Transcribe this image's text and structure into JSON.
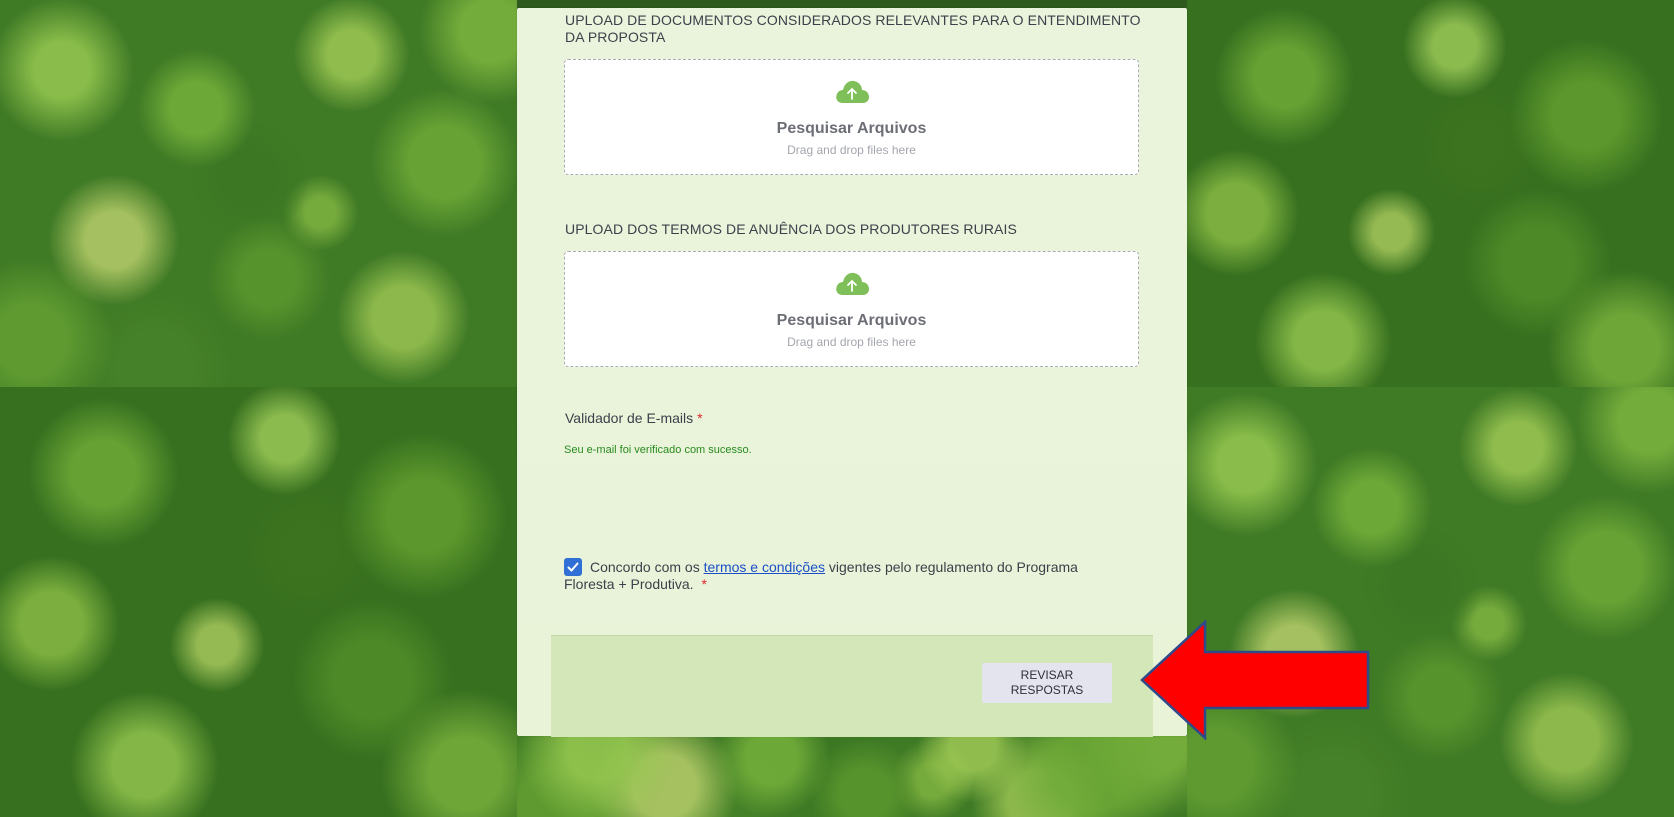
{
  "upload_documents": {
    "label": "UPLOAD DE DOCUMENTOS CONSIDERADOS RELEVANTES PARA O ENTENDIMENTO DA PROPOSTA",
    "title": "Pesquisar Arquivos",
    "subtitle": "Drag and drop files here",
    "icon": "cloud-upload-icon"
  },
  "upload_terms": {
    "label": "UPLOAD DOS TERMOS DE ANUÊNCIA DOS PRODUTORES RURAIS",
    "title": "Pesquisar Arquivos",
    "subtitle": "Drag and drop files here",
    "icon": "cloud-upload-icon"
  },
  "email_validator": {
    "label": "Validador de E-mails",
    "required_mark": "*",
    "success_message": "Seu e-mail foi verificado com sucesso."
  },
  "terms": {
    "checked": true,
    "text_before": "Concordo com os",
    "link_text": "termos e condições",
    "text_after": " vigentes pelo regulamento do Programa Floresta + Produtiva.",
    "required_mark": "*"
  },
  "footer": {
    "review_button_label": "REVISAR RESPOSTAS"
  },
  "colors": {
    "card_background": "#eaf4dc",
    "footer_background": "#d3e7b8",
    "accent_checkbox": "#2f6fd6",
    "link": "#1a4fc8",
    "success": "#2a8b1f",
    "required": "#e0262e",
    "annotation_arrow": "#ff0000"
  }
}
